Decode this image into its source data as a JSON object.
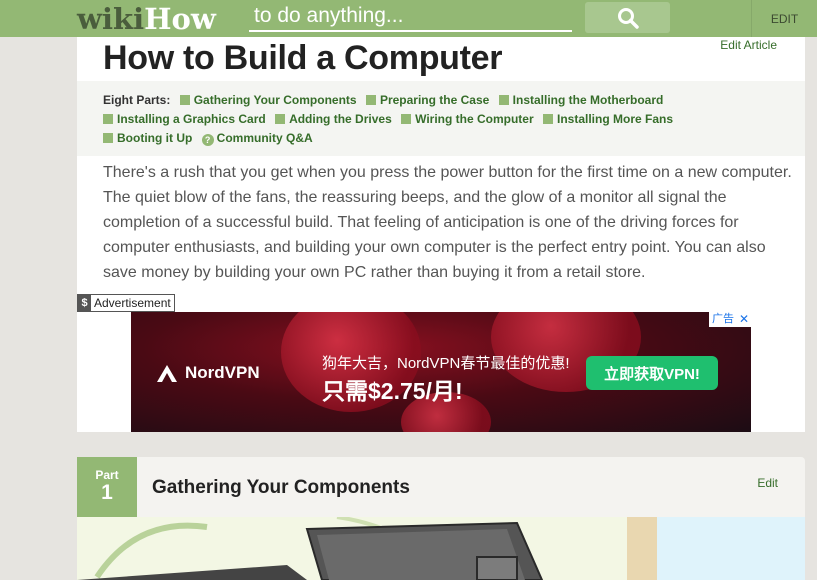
{
  "header": {
    "logo_wiki": "wiki",
    "logo_how": "How",
    "search_placeholder": "to do anything...",
    "search_icon": "search-icon",
    "edit_label": "EDIT"
  },
  "article": {
    "edit_label": "Edit Article",
    "title": "How to Build a Computer",
    "toc_label": "Eight Parts:",
    "toc_items": [
      "Gathering Your Components",
      "Preparing the Case",
      "Installing the Motherboard",
      "Installing a Graphics Card",
      "Adding the Drives",
      "Wiring the Computer",
      "Installing More Fans",
      "Booting it Up",
      "Community Q&A"
    ],
    "intro": "There's a rush that you get when you press the power button for the first time on a new computer. The quiet blow of the fans, the reassuring beeps, and the glow of a monitor all signal the completion of a successful build. That feeling of anticipation is one of the driving forces for computer enthusiasts, and building your own computer is the perfect entry point. You can also save money by building your own PC rather than buying it from a retail store."
  },
  "ad": {
    "label_icon": "$",
    "label": "Advertisement",
    "tag": "广告",
    "close": "✕",
    "brand": "NordVPN",
    "line1": "狗年大吉，NordVPN春节最佳的优惠!",
    "line2": "只需$2.75/月!",
    "cta": "立即获取VPN!"
  },
  "part": {
    "word": "Part",
    "number": "1",
    "title": "Gathering Your Components",
    "edit_label": "Edit"
  },
  "colors": {
    "brand_green": "#93b874",
    "link_green": "#366d2a"
  }
}
